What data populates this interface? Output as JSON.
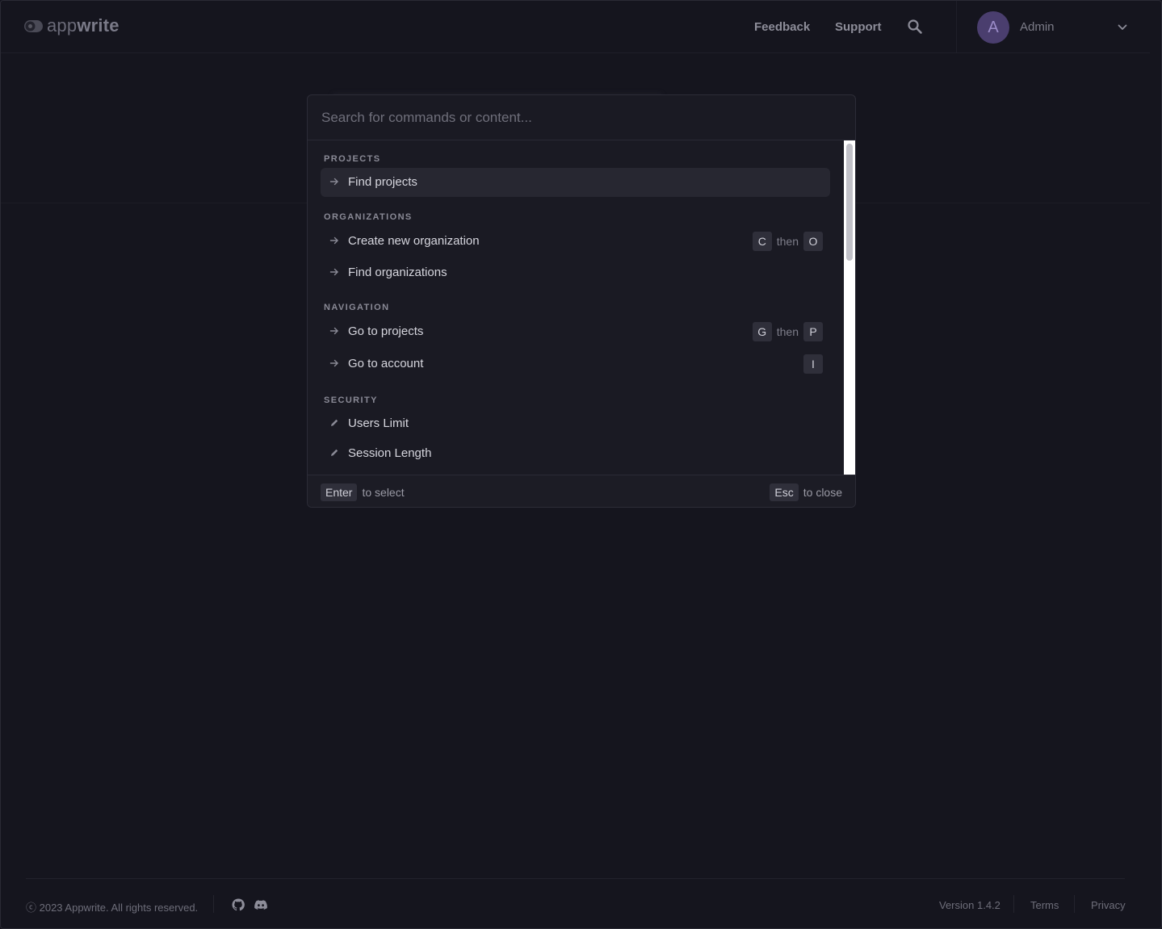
{
  "header": {
    "logo_text_light": "app",
    "logo_text_bold": "write",
    "nav": [
      "Feedback",
      "Support"
    ],
    "search_icon": "search-icon",
    "avatar_initial": "A",
    "user_name": "Admin",
    "chevron_icon": "chevron-down-icon"
  },
  "palette": {
    "search_placeholder": "Search for commands or content...",
    "sections": [
      {
        "title": "PROJECTS",
        "items": [
          {
            "label": "Find projects",
            "icon": "arrow-right-icon",
            "active": true
          }
        ]
      },
      {
        "title": "ORGANIZATIONS",
        "items": [
          {
            "label": "Create new organization",
            "icon": "arrow-right-icon",
            "shortcut": [
              "C",
              "then",
              "O"
            ]
          },
          {
            "label": "Find organizations",
            "icon": "arrow-right-icon"
          }
        ]
      },
      {
        "title": "NAVIGATION",
        "items": [
          {
            "label": "Go to projects",
            "icon": "arrow-right-icon",
            "shortcut": [
              "G",
              "then",
              "P"
            ]
          },
          {
            "label": "Go to account",
            "icon": "arrow-right-icon",
            "shortcut": [
              "I"
            ]
          }
        ]
      },
      {
        "title": "SECURITY",
        "items": [
          {
            "label": "Users Limit",
            "icon": "pencil-icon"
          },
          {
            "label": "Session Length",
            "icon": "pencil-icon"
          }
        ]
      }
    ],
    "footer": {
      "select_key": "Enter",
      "select_text": "to select",
      "close_key": "Esc",
      "close_text": "to close"
    }
  },
  "footer": {
    "copyright": "ⓒ 2023 Appwrite. All rights reserved.",
    "github_icon": "github-icon",
    "discord_icon": "discord-icon",
    "version": "Version 1.4.2",
    "terms": "Terms",
    "privacy": "Privacy"
  },
  "colors": {
    "background": "#15151e",
    "palette_bg": "#1a1a23",
    "active_item": "#272731",
    "avatar": "#4a3e6e"
  }
}
